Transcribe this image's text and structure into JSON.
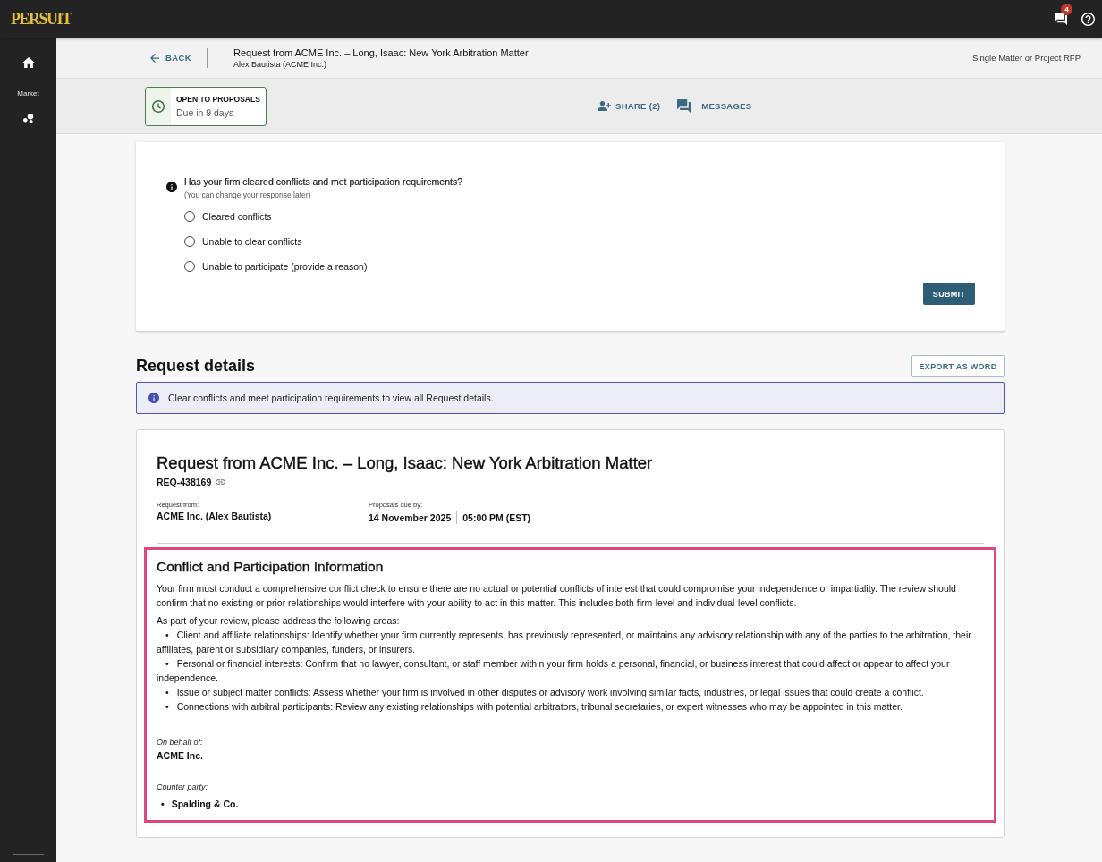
{
  "top_bar": {
    "logo": "PERSUIT",
    "notification_count": "4"
  },
  "sidebar": {
    "section_label": "Market"
  },
  "header": {
    "back": "BACK",
    "title": "Request from ACME Inc. – Long, Isaac: New York Arbitration Matter",
    "subtitle": "Alex Bautista (ACME Inc.)",
    "request_type": "Single Matter or Project RFP"
  },
  "status": {
    "label": "OPEN TO PROPOSALS",
    "due": "Due in 9 days"
  },
  "actions": [
    {
      "kind": "share",
      "label": "SHARE (2)"
    },
    {
      "kind": "messages",
      "label": "MESSAGES"
    }
  ],
  "participation": {
    "question": "Has your firm cleared conflicts and met participation requirements?",
    "hint": "(You can change your response later)",
    "options": [
      {
        "label": "Cleared conflicts",
        "selected": false
      },
      {
        "label": "Unable to clear conflicts",
        "selected": false
      },
      {
        "label": "Unable to participate (provide a reason)",
        "selected": false
      }
    ],
    "submit": "SUBMIT"
  },
  "request_details": {
    "heading": "Request details",
    "export": "EXPORT AS WORD",
    "notice": "Clear conflicts and meet participation requirements to view all Request details.",
    "title": "Request from ACME Inc. – Long, Isaac: New York Arbitration Matter",
    "reference": "REQ-438169",
    "request_from": {
      "label": "Request from:",
      "value": "ACME Inc. (Alex Bautista)"
    },
    "proposals_due": {
      "label": "Proposals due by:",
      "date": "14 November 2025",
      "time": "05:00 PM (EST)"
    }
  },
  "conflict_info": {
    "highlighted": true,
    "heading": "Conflict and Participation Information",
    "paragraph": "Your firm must conduct a comprehensive conflict check to ensure there are no actual or potential conflicts of interest that could compromise your independence or impartiality. The review should confirm that no existing or prior relationships would interfere with your ability to act in this matter. This includes both firm-level and individual-level conflicts.",
    "intro": "As part of your review, please address the following areas:",
    "areas": [
      {
        "marker": "•",
        "text": "Client and affiliate relationships: Identify whether your firm currently represents, has previously represented, or maintains any advisory relationship with any of the parties to the arbitration, their affiliates, parent or subsidiary companies, funders, or insurers."
      },
      {
        "marker": "•",
        "text": "Personal or financial interests: Confirm that no lawyer, consultant, or staff member within your firm holds a personal, financial, or business interest that could affect or appear to affect your independence."
      },
      {
        "marker": "•",
        "text": "Issue or subject matter conflicts: Assess whether your firm is involved in other disputes or advisory work involving similar facts, industries, or legal issues that could create a conflict."
      },
      {
        "marker": "•",
        "text": "Connections with arbitral participants: Review any existing relationships with potential arbitrators, tribunal secretaries, or expert witnesses who may be appointed in this matter."
      }
    ],
    "on_behalf": {
      "label": "On behalf of:",
      "value": "ACME Inc."
    },
    "counter_party": {
      "label": "Counter party:",
      "items": [
        {
          "marker": "•",
          "text": "Spalding & Co."
        }
      ]
    }
  }
}
